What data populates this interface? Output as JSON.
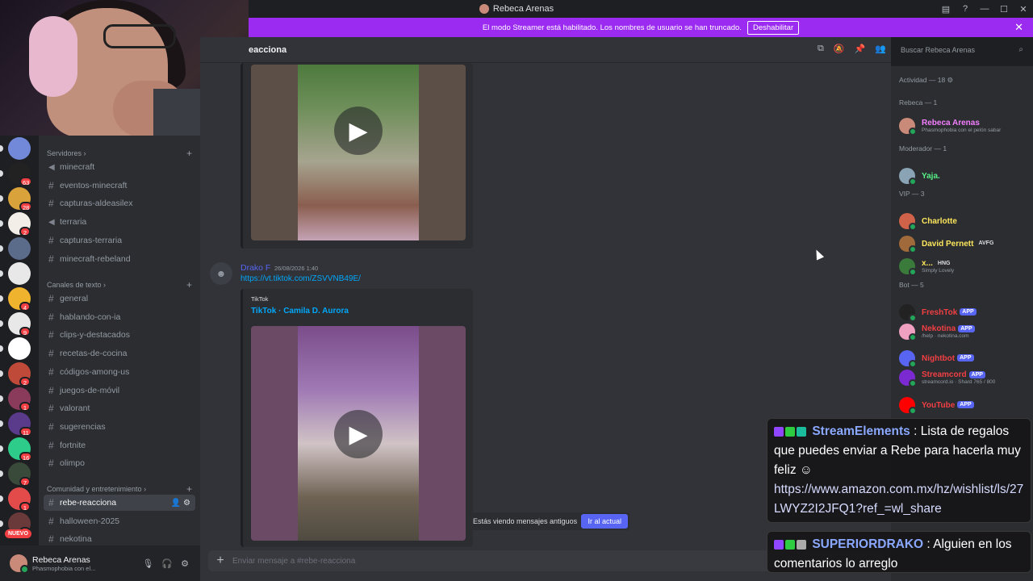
{
  "window": {
    "title": "Rebeca Arenas"
  },
  "banner": {
    "text": "El modo Streamer está habilitado. Los nombres de usuario se han truncado.",
    "button": "Deshabilitar"
  },
  "header": {
    "channel": "eacciona",
    "search_placeholder": "Buscar Rebeca Arenas"
  },
  "servers": [
    {
      "badge": ""
    },
    {
      "badge": "63"
    },
    {
      "badge": "28"
    },
    {
      "badge": "2"
    },
    {
      "badge": ""
    },
    {
      "badge": ""
    },
    {
      "badge": "4"
    },
    {
      "badge": "9"
    },
    {
      "badge": ""
    },
    {
      "badge": "2"
    },
    {
      "badge": "1"
    },
    {
      "badge": "11"
    },
    {
      "badge": "16"
    },
    {
      "badge": "7"
    },
    {
      "badge": "1"
    },
    {
      "badge": "1"
    }
  ],
  "rail": {
    "nuevo": "NUEVO"
  },
  "sidebar": {
    "cat_servidores": "Servidores",
    "cat_texto": "Canales de texto",
    "cat_comunidad": "Comunidad y entretenimiento",
    "servidores": [
      "minecraft",
      "eventos-minecraft",
      "capturas-aldeasilex",
      "terraria",
      "capturas-terraria",
      "minecraft-rebeland"
    ],
    "texto": [
      "general",
      "hablando-con-ia",
      "clips-y-destacados",
      "recetas-de-cocina",
      "códigos-among-us",
      "juegos-de-móvil",
      "valorant",
      "sugerencias",
      "fortnite",
      "olimpo"
    ],
    "comunidad": [
      "rebe-reacciona",
      "halloween-2025",
      "nekotina"
    ]
  },
  "user": {
    "name": "Rebeca Arenas",
    "status": "Phasmophobia con el..."
  },
  "message": {
    "author": "Drako F",
    "time": "26/08/2026 1:40",
    "link": "https://vt.tiktok.com/ZSVVNB49E/",
    "embed_provider": "TikTok",
    "embed_title": "TikTok · Camila D. Aurora"
  },
  "jump": {
    "text": "Estás viendo mensajes antiguos",
    "button": "Ir al actual"
  },
  "composer": {
    "placeholder": "Enviar mensaje a #rebe-reacciona"
  },
  "members": {
    "activity": "Actividad — 18",
    "groups": [
      {
        "label": "Rebeca — 1",
        "members": [
          {
            "name": "Rebeca Arenas",
            "sub": "Phasmophobia con el pelón sabar",
            "tag": "",
            "color": "#f47fff"
          }
        ]
      },
      {
        "label": "Moderador — 1",
        "members": [
          {
            "name": "Yaja.",
            "sub": "",
            "tag": "",
            "color": "#57f287"
          }
        ]
      },
      {
        "label": "VIP — 3",
        "members": [
          {
            "name": "Charlotte",
            "sub": "",
            "tag": "",
            "color": "#fee75c"
          },
          {
            "name": "David Pernett",
            "sub": "",
            "tag": "AVFG",
            "color": "#fee75c"
          },
          {
            "name": "x...",
            "sub": "Simply Lovely",
            "tag": "HNG",
            "color": "#fee75c"
          }
        ]
      },
      {
        "label": "Bot — 5",
        "members": [
          {
            "name": "FreshTok",
            "sub": "",
            "tag": "APP",
            "color": "#f23f43"
          },
          {
            "name": "Nekotina",
            "sub": "/help · nekotina.com",
            "tag": "APP",
            "color": "#f23f43"
          },
          {
            "name": "Nightbot",
            "sub": "",
            "tag": "APP",
            "color": "#f23f43"
          },
          {
            "name": "Streamcord",
            "sub": "streamcord.io · Shard 765 / 800",
            "tag": "APP",
            "color": "#f23f43"
          },
          {
            "name": "YouTube",
            "sub": "",
            "tag": "APP",
            "color": "#f23f43"
          }
        ]
      }
    ]
  },
  "overlay": [
    {
      "author": "StreamElements",
      "text": "Lista de regalos que puedes enviar a Rebe para hacerla muy feliz",
      "link": "https://www.amazon.com.mx/hz/wishlist/ls/27LWYZ2I2JFQ1?ref_=wl_share"
    },
    {
      "author": "SUPERIORDRAKO",
      "text": "Alguien en los comentarios lo arreglo"
    }
  ]
}
